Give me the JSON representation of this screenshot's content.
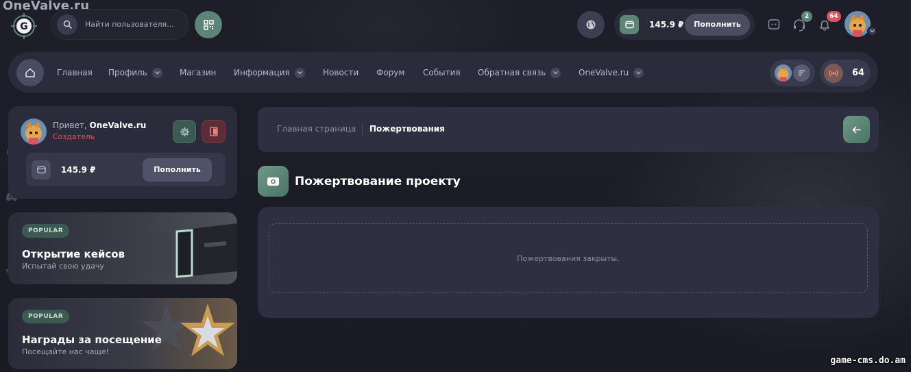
{
  "watermark": {
    "top": "OneValve.ru",
    "bottom": "game-cms.do.am"
  },
  "header": {
    "search_placeholder": "Найти пользователя...",
    "balance": "145.9 ₽",
    "topup_label": "Пополнить",
    "support_count": "2",
    "notifications_count": "64"
  },
  "nav": {
    "items": [
      {
        "label": "Главная",
        "has_dropdown": false
      },
      {
        "label": "Профиль",
        "has_dropdown": true
      },
      {
        "label": "Магазин",
        "has_dropdown": false
      },
      {
        "label": "Информация",
        "has_dropdown": true
      },
      {
        "label": "Новости",
        "has_dropdown": false
      },
      {
        "label": "Форум",
        "has_dropdown": false
      },
      {
        "label": "События",
        "has_dropdown": false
      },
      {
        "label": "Обратная связь",
        "has_dropdown": true
      },
      {
        "label": "OneValve.ru",
        "has_dropdown": true
      }
    ],
    "online_count": "64"
  },
  "sidebar": {
    "profile": {
      "greeting": "Привет,",
      "username": "OneValve.ru",
      "role": "Создатель",
      "balance": "145.9 ₽",
      "topup_label": "Пополнить"
    },
    "promos": [
      {
        "badge": "POPULAR",
        "title": "Открытие кейсов",
        "subtitle": "Испытай свою удачу"
      },
      {
        "badge": "POPULAR",
        "title": "Награды за посещение",
        "subtitle": "Посещайте нас чаще!"
      }
    ]
  },
  "breadcrumb": {
    "home": "Главная страница",
    "current": "Пожертвования"
  },
  "page": {
    "title": "Пожертвование проекту",
    "empty_message": "Пожертвования закрыты."
  },
  "colors": {
    "accent": "#5d8577",
    "danger": "#d9545c",
    "panel": "#2e2f40",
    "background": "#1b1c26"
  }
}
